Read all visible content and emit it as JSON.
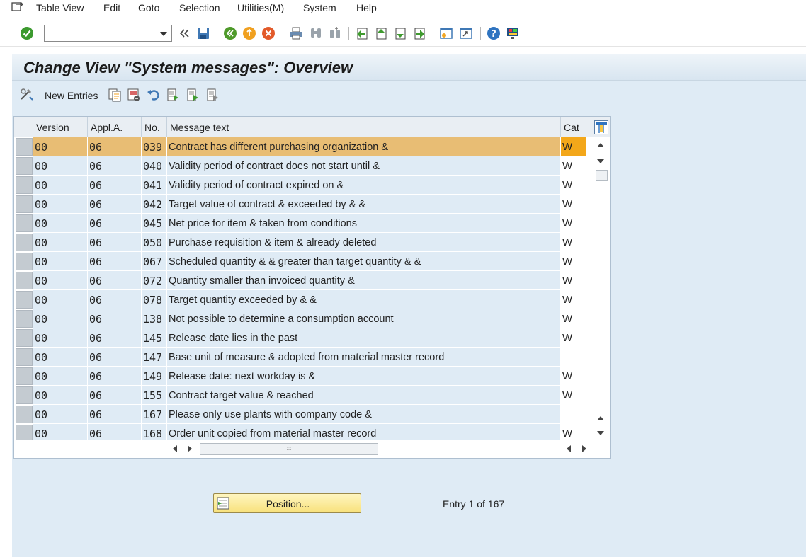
{
  "menubar": {
    "items": [
      "Table View",
      "Edit",
      "Goto",
      "Selection",
      "Utilities(M)",
      "System",
      "Help"
    ]
  },
  "toolbar": {
    "command_field_value": "",
    "icons": [
      "enter-icon",
      "back-icon",
      "save-icon",
      "back-green-icon",
      "exit-icon",
      "cancel-icon",
      "print-icon",
      "find-icon",
      "find-next-icon",
      "first-page-icon",
      "previous-page-icon",
      "next-page-icon",
      "last-page-icon",
      "create-session-icon",
      "shortcut-icon",
      "help-icon",
      "customize-layout-icon"
    ]
  },
  "page": {
    "title": "Change View \"System messages\": Overview"
  },
  "app_toolbar": {
    "new_entries_label": "New Entries",
    "icons": [
      "display-change-icon",
      "copy-icon",
      "delete-icon",
      "undo-icon",
      "select-all-icon",
      "select-block-icon",
      "deselect-all-icon"
    ]
  },
  "table": {
    "columns": [
      "Version",
      "Appl.A.",
      "No.",
      "Message text",
      "Cat"
    ],
    "rows": [
      {
        "version": "00",
        "appl": "06",
        "no": "039",
        "text": "Contract has different purchasing organization &",
        "cat": "W",
        "highlighted": true
      },
      {
        "version": "00",
        "appl": "06",
        "no": "040",
        "text": "Validity period of contract does not start until &",
        "cat": "W"
      },
      {
        "version": "00",
        "appl": "06",
        "no": "041",
        "text": "Validity period of contract expired on &",
        "cat": "W"
      },
      {
        "version": "00",
        "appl": "06",
        "no": "042",
        "text": "Target value of contract & exceeded by & &",
        "cat": "W"
      },
      {
        "version": "00",
        "appl": "06",
        "no": "045",
        "text": "Net price for item & taken from conditions",
        "cat": "W"
      },
      {
        "version": "00",
        "appl": "06",
        "no": "050",
        "text": "Purchase requisition & item & already deleted",
        "cat": "W"
      },
      {
        "version": "00",
        "appl": "06",
        "no": "067",
        "text": "Scheduled quantity & & greater than target quantity & &",
        "cat": "W"
      },
      {
        "version": "00",
        "appl": "06",
        "no": "072",
        "text": "Quantity smaller than invoiced quantity &",
        "cat": "W"
      },
      {
        "version": "00",
        "appl": "06",
        "no": "078",
        "text": "Target quantity exceeded by  & &",
        "cat": "W"
      },
      {
        "version": "00",
        "appl": "06",
        "no": "138",
        "text": "Not possible to determine a consumption account",
        "cat": "W"
      },
      {
        "version": "00",
        "appl": "06",
        "no": "145",
        "text": "Release date lies in the past",
        "cat": "W"
      },
      {
        "version": "00",
        "appl": "06",
        "no": "147",
        "text": "Base unit of measure & adopted from material master record",
        "cat": ""
      },
      {
        "version": "00",
        "appl": "06",
        "no": "149",
        "text": "Release date: next workday is &",
        "cat": "W"
      },
      {
        "version": "00",
        "appl": "06",
        "no": "155",
        "text": "Contract target value & reached",
        "cat": "W"
      },
      {
        "version": "00",
        "appl": "06",
        "no": "167",
        "text": "Please only use plants with company code &",
        "cat": ""
      },
      {
        "version": "00",
        "appl": "06",
        "no": "168",
        "text": "Order unit copied from material master record",
        "cat": "W"
      }
    ]
  },
  "footer": {
    "position_button_label": "Position...",
    "entry_info": "Entry 1 of 167"
  },
  "colors": {
    "background": "#dfebf5",
    "highlight_row": "#e8bd74",
    "highlight_cat": "#f3a71a",
    "button_yellow": "#f8e17c"
  }
}
